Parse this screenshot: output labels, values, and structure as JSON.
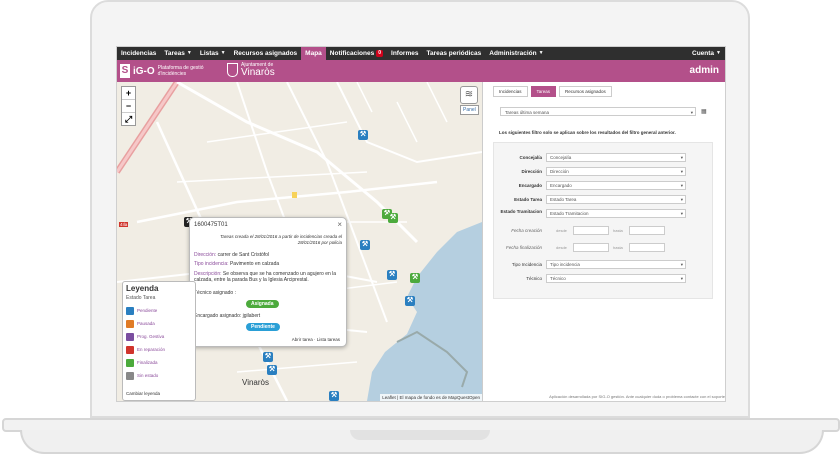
{
  "nav": {
    "items": [
      {
        "label": "Incidencias",
        "caret": false,
        "active": false
      },
      {
        "label": "Tareas",
        "caret": true,
        "active": false
      },
      {
        "label": "Listas",
        "caret": true,
        "active": false
      },
      {
        "label": "Recursos asignados",
        "caret": false,
        "active": false
      },
      {
        "label": "Mapa",
        "caret": false,
        "active": true
      },
      {
        "label": "Notificaciones",
        "caret": false,
        "active": false,
        "badge": "0"
      },
      {
        "label": "Informes",
        "caret": false,
        "active": false
      },
      {
        "label": "Tareas periódicas",
        "caret": false,
        "active": false
      },
      {
        "label": "Administración",
        "caret": true,
        "active": false
      }
    ],
    "account_label": "Cuenta"
  },
  "brand": {
    "logo_letter": "S",
    "logo_name": "iG-O",
    "logo_sub": "Plataforma de gestió d'incidències",
    "city_top": "Ajuntament de",
    "city_name": "Vinaròs",
    "user": "admin",
    "accent": "#b3508a"
  },
  "map": {
    "zoom_in": "+",
    "zoom_out": "−",
    "fullscreen": "⤢",
    "layers_icon": "layers-icon",
    "panel_label": "Panel",
    "road_badge": "4Ila",
    "place_label": "Vinaròs",
    "attribution": "Leaflet | El mapa de fondo es de MapQuestOpen"
  },
  "popup": {
    "id": "1600475T01",
    "close": "×",
    "created": "Tareas creada el 28/01/2016 a partir de incidencias creada el 28/01/2016 por policia",
    "direccion_label": "Dirección:",
    "direccion": "carrer de Sant Cristòfol",
    "tipo_label": "Tipo incidencia:",
    "tipo": "Pavimento en calzada",
    "descripcion_label": "Descripción:",
    "descripcion": "Se observa que se ha comenzado un agujero en la calzada, entre la parada Bus y la Iglesia Arciprestal.",
    "tecnico_label": "Técnico asignado :",
    "asignada": "Asignada",
    "encargado_label": "Encargado asignado:",
    "encargado": "jgilabert",
    "pendiente": "Pendiente",
    "link_abrir": "Abrir tarea",
    "link_lista": "Lista tareas"
  },
  "legend": {
    "title": "Leyenda",
    "subtitle": "Estado Tarea",
    "items": [
      {
        "label": "Pendiente",
        "color": "#2a7fc0"
      },
      {
        "label": "Pausada",
        "color": "#e07b26"
      },
      {
        "label": "Prog. Gestiva",
        "color": "#7b4ea0"
      },
      {
        "label": "En reparación",
        "color": "#d0342c"
      },
      {
        "label": "Finalizada",
        "color": "#4caa3c"
      },
      {
        "label": "Sin estado",
        "color": "#888888"
      }
    ],
    "button": "Cambiar leyenda"
  },
  "panel": {
    "tabs": [
      {
        "label": "Incidencias",
        "active": false
      },
      {
        "label": "Tareas",
        "active": true
      },
      {
        "label": "Recursos asignados",
        "active": false
      }
    ],
    "period": "Tareas última semana",
    "notice": "Los siguientes filtro solo se aplican sobre los resultados del filtro general anterior.",
    "filters": [
      {
        "label": "Concejalía",
        "value": "Concejalía"
      },
      {
        "label": "Dirección",
        "value": "Dirección"
      },
      {
        "label": "Encargado",
        "value": "Encargado"
      },
      {
        "label": "Estado Tarea",
        "value": "Estado Tarea"
      },
      {
        "label": "Estado Tramitacion",
        "value": "Estado Tramitacion"
      }
    ],
    "fecha_creacion": "Fecha creación",
    "fecha_finalizacion": "Fecha finalización",
    "desde": "desde",
    "hasta": "hasta",
    "tipo_label": "Tipo Incidencia",
    "tipo_value": "Tipo incidencia",
    "tecnico_label": "Técnico",
    "tecnico_value": "Técnico",
    "footer": "Aplicación desarrollada por SIG-O gestión. Ante cualquier duda o problema contacte con el soporte"
  }
}
